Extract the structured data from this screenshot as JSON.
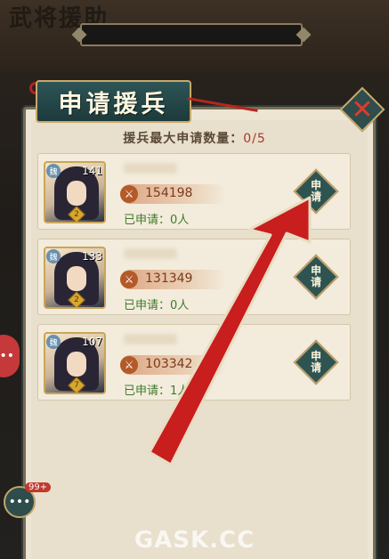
{
  "background": {
    "title": "武将援助"
  },
  "dialog": {
    "title": "申请援兵",
    "count_label": "援兵最大申请数量：",
    "count_value": "0/5"
  },
  "cards": [
    {
      "badge": "魏",
      "level": "141",
      "star": "2",
      "power": "154198",
      "applied": "已申请：0人",
      "button": "申请"
    },
    {
      "badge": "魏",
      "level": "133",
      "star": "2",
      "power": "131349",
      "applied": "已申请：0人",
      "button": "申请"
    },
    {
      "badge": "魏",
      "level": "107",
      "star": "7",
      "power": "103342",
      "applied": "已申请：1人",
      "button": "申请"
    }
  ],
  "side": {
    "chat_badge": "99+"
  },
  "watermark": "GASK.CC",
  "colors": {
    "accent_teal": "#2e5452",
    "arrow_red": "#c81e1e",
    "gold": "#c8a969"
  }
}
